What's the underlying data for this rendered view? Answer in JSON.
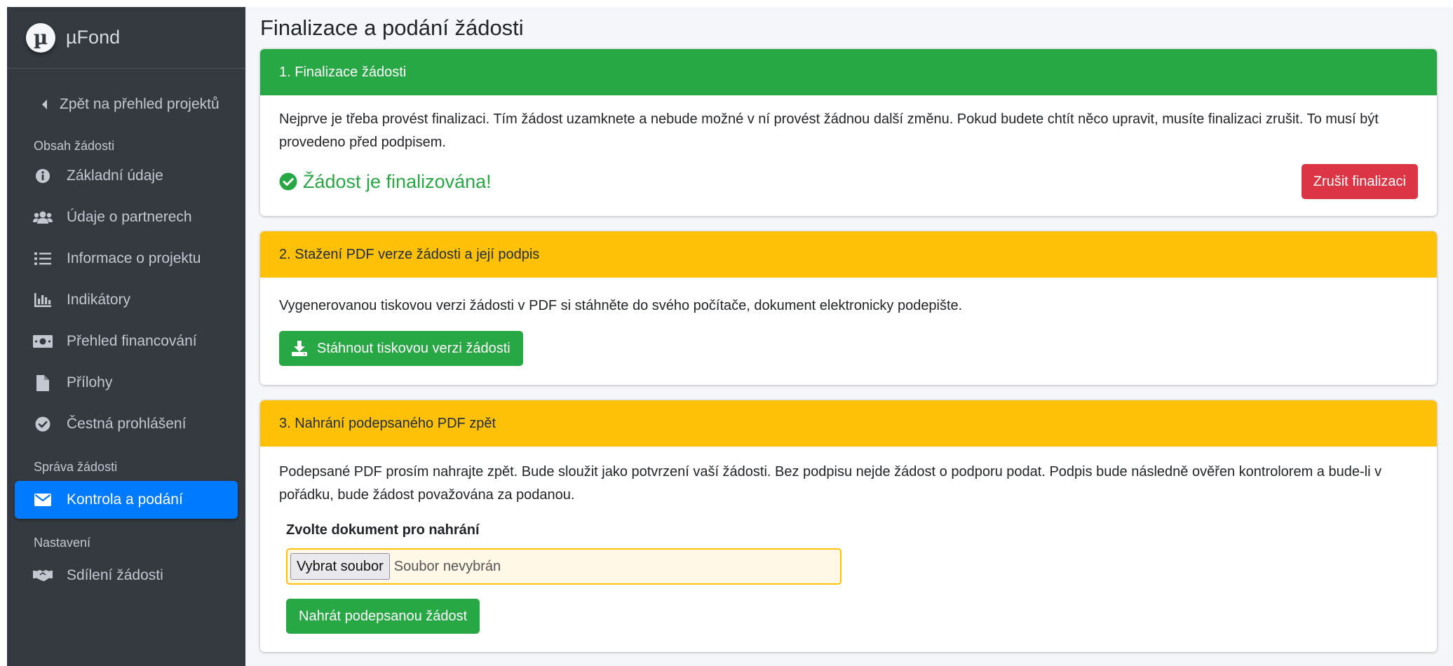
{
  "brand": {
    "logo_letter": "µ",
    "name": "µFond"
  },
  "sidebar": {
    "back_link": "Zpět na přehled projektů",
    "section_content": "Obsah žádosti",
    "content_items": [
      {
        "label": "Základní údaje",
        "icon": "info-circle-icon"
      },
      {
        "label": "Údaje o partnerech",
        "icon": "users-icon"
      },
      {
        "label": "Informace o projektu",
        "icon": "list-icon"
      },
      {
        "label": "Indikátory",
        "icon": "chart-bar-icon"
      },
      {
        "label": "Přehled financování",
        "icon": "money-bill-icon"
      },
      {
        "label": "Přílohy",
        "icon": "file-icon"
      },
      {
        "label": "Čestná prohlášení",
        "icon": "check-circle-icon"
      }
    ],
    "section_management": "Správa žádosti",
    "active_item": {
      "label": "Kontrola a podání",
      "icon": "envelope-icon"
    },
    "section_settings": "Nastavení",
    "settings_items": [
      {
        "label": "Sdílení žádosti",
        "icon": "handshake-icon"
      }
    ]
  },
  "main": {
    "title": "Finalizace a podání žádosti",
    "card1": {
      "header": "1. Finalizace žádosti",
      "text": "Nejprve je třeba provést finalizaci. Tím žádost uzamknete a nebude možné v ní provést žádnou další změnu. Pokud budete chtít něco upravit, musíte finalizaci zrušit. To musí být provedeno před podpisem.",
      "status": "Žádost je finalizována!",
      "cancel_button": "Zrušit finalizaci"
    },
    "card2": {
      "header": "2. Stažení PDF verze žádosti a její podpis",
      "text": "Vygenerovanou tiskovou verzi žádosti v PDF si stáhněte do svého počítače, dokument elektronicky podepište.",
      "download_button": "Stáhnout tiskovou verzi žádosti"
    },
    "card3": {
      "header": "3. Nahrání podepsaného PDF zpět",
      "text": "Podepsané PDF prosím nahrajte zpět. Bude sloužit jako potvrzení vaší žádosti. Bez podpisu nejde žádost o podporu podat. Podpis bude následně ověřen kontrolorem a bude-li v pořádku, bude žádost považována za podanou.",
      "upload_label": "Zvolte dokument pro nahrání",
      "file_button": "Vybrat soubor",
      "file_status": "Soubor nevybrán",
      "upload_button": "Nahrát podepsanou žádost"
    }
  },
  "colors": {
    "sidebar_bg": "#343a40",
    "active_blue": "#007bff",
    "success_green": "#28a745",
    "warning_yellow": "#ffc107",
    "danger_red": "#dc3545"
  }
}
